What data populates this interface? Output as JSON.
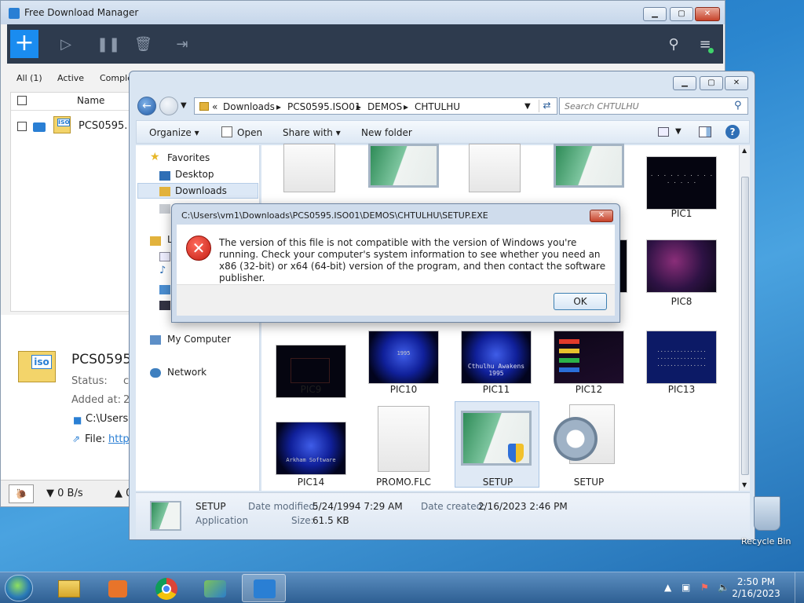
{
  "fdm": {
    "title": "Free Download Manager",
    "filters": [
      "All (1)",
      "Active",
      "Complete"
    ],
    "column_name": "Name",
    "list_item_name": "PCS0595.",
    "detail_name": "PCS0595",
    "detail_status": "Status:",
    "detail_status_value": "c",
    "detail_added": "Added at:",
    "detail_added_value": "2",
    "detail_path": "C:\\Users",
    "detail_file": "File:",
    "detail_file_link": "https",
    "speed_down": "▼ 0 B/s",
    "speed_up": "▲ 0"
  },
  "explorer": {
    "breadcrumb": [
      "«",
      "Downloads",
      "PCS0595.ISO01",
      "DEMOS",
      "CHTULHU"
    ],
    "search_placeholder": "Search CHTULHU",
    "toolbar": {
      "organize": "Organize ▾",
      "open": "Open",
      "share": "Share with ▾",
      "new_folder": "New folder"
    },
    "nav": {
      "favorites": "Favorites",
      "desktop": "Desktop",
      "downloads": "Downloads",
      "libraries": "L",
      "my_computer": "My Computer",
      "network": "Network"
    },
    "files": {
      "pic1": "PIC1",
      "pic8": "PIC8",
      "pic9": "PIC9",
      "pic10": "PIC10",
      "pic11": "PIC11",
      "pic12": "PIC12",
      "pic13": "PIC13",
      "pic14": "PIC14",
      "promo": "PROMO.FLC",
      "setup_exe": "SETUP",
      "setup_cfg": "SETUP"
    },
    "thumb_text": {
      "pic10": "1995",
      "pic11": "Cthulhu Awakens\n1995",
      "pic14": "Arkham Software"
    },
    "details": {
      "name": "SETUP",
      "type": "Application",
      "modified_label": "Date modified:",
      "modified_value": "5/24/1994 7:29 AM",
      "created_label": "Date created:",
      "created_value": "2/16/2023 2:46 PM",
      "size_label": "Size:",
      "size_value": "61.5 KB"
    }
  },
  "dialog": {
    "title": "C:\\Users\\vm1\\Downloads\\PCS0595.ISO01\\DEMOS\\CHTULHU\\SETUP.EXE",
    "message": "The version of this file is not compatible with the version of Windows you're running. Check your computer's system information to see whether you need an x86 (32-bit) or x64 (64-bit) version of the program, and then contact the software publisher.",
    "ok": "OK"
  },
  "desktop": {
    "recycle_bin": "Recycle Bin"
  },
  "taskbar": {
    "time": "2:50 PM",
    "date": "2/16/2023"
  }
}
